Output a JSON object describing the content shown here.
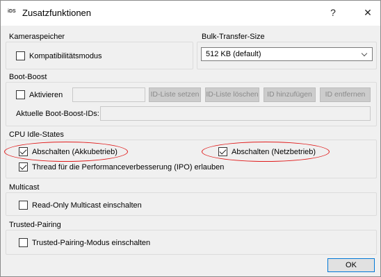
{
  "window": {
    "icon_text": "iDS",
    "title": "Zusatzfunktionen",
    "help_glyph": "?",
    "close_glyph": "✕"
  },
  "kameraspeicher": {
    "label": "Kameraspeicher",
    "kompat_label": "Kompatibilitätsmodus",
    "kompat_checked": false
  },
  "bulk": {
    "label": "Bulk-Transfer-Size",
    "selected": "512 KB (default)"
  },
  "boost": {
    "label": "Boot-Boost",
    "aktivieren_label": "Aktivieren",
    "aktivieren_checked": false,
    "id_input_value": "",
    "buttons": {
      "set": "ID-Liste setzen",
      "clear": "ID-Liste löschen",
      "add": "ID hinzufügen",
      "remove": "ID entfernen"
    },
    "current_ids_label": "Aktuelle Boot-Boost-IDs:",
    "current_ids_value": ""
  },
  "cpu": {
    "label": "CPU Idle-States",
    "akku_label": "Abschalten (Akkubetrieb)",
    "akku_checked": true,
    "netz_label": "Abschalten (Netzbetrieb)",
    "netz_checked": true,
    "ipo_label": "Thread für die Performanceverbesserung (IPO) erlauben",
    "ipo_checked": true
  },
  "multicast": {
    "label": "Multicast",
    "readonly_label": "Read-Only Multicast einschalten",
    "readonly_checked": false
  },
  "trusted": {
    "label": "Trusted-Pairing",
    "mode_label": "Trusted-Pairing-Modus einschalten",
    "mode_checked": false
  },
  "ok_label": "OK",
  "colors": {
    "annotation": "#e01818",
    "dialog_bg": "#f0f0f0",
    "focus_border": "#0078d7"
  }
}
